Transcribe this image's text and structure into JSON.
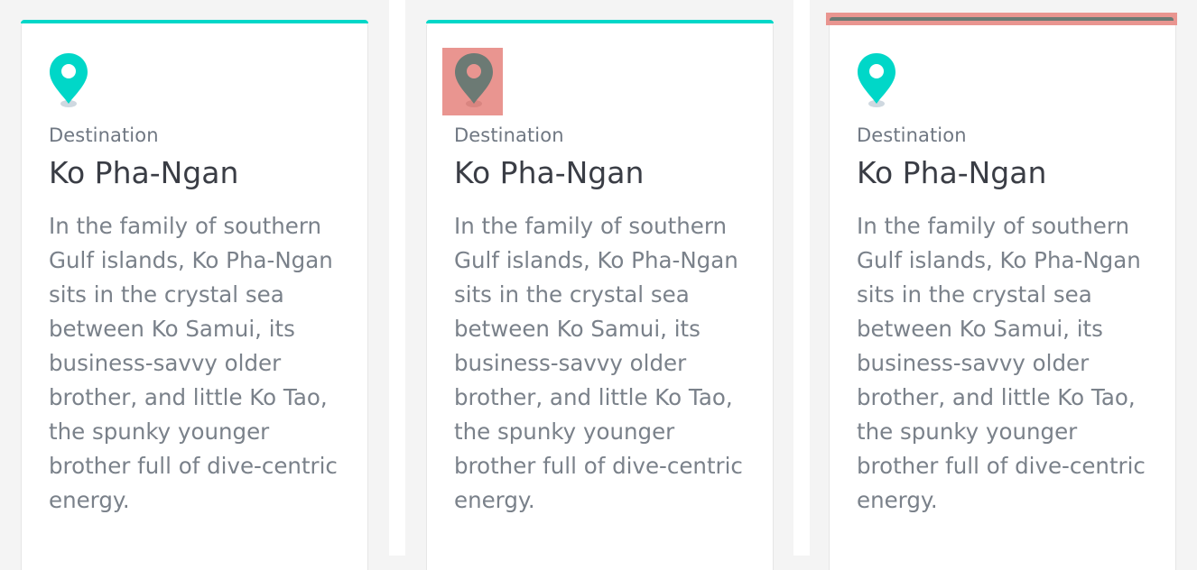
{
  "theme": {
    "accent": "#00d7c8",
    "highlight": "#e99590",
    "highlight_pin": "#6c7a74",
    "text_title": "#3a3d45",
    "text_muted": "#7a818a"
  },
  "cards": [
    {
      "icon": "map-pin-icon",
      "eyebrow": "Destination",
      "title": "Ko Pha-Ngan",
      "description_lines": [
        "In the family of southern",
        "Gulf islands, Ko Pha-Ngan",
        "sits in the crystal sea",
        "between Ko Samui, its",
        "business-savvy older",
        "brother, and little Ko Tao,",
        "the spunky younger",
        "brother full of dive-centric",
        "energy."
      ]
    },
    {
      "icon": "map-pin-icon",
      "eyebrow": "Destination",
      "title": "Ko Pha-Ngan",
      "description_lines": [
        "In the family of southern",
        "Gulf islands, Ko Pha-Ngan",
        "sits in the crystal sea",
        "between Ko Samui, its",
        "business-savvy older",
        "brother, and little Ko Tao,",
        "the spunky younger",
        "brother full of dive-centric",
        "energy."
      ]
    },
    {
      "icon": "map-pin-icon",
      "eyebrow": "Destination",
      "title": "Ko Pha-Ngan",
      "description_lines": [
        "In the family of southern",
        "Gulf islands, Ko Pha-Ngan",
        "sits in the crystal sea",
        "between Ko Samui, its",
        "business-savvy older",
        "brother, and little Ko Tao,",
        "the spunky younger",
        "brother full of dive-centric",
        "energy."
      ]
    }
  ]
}
